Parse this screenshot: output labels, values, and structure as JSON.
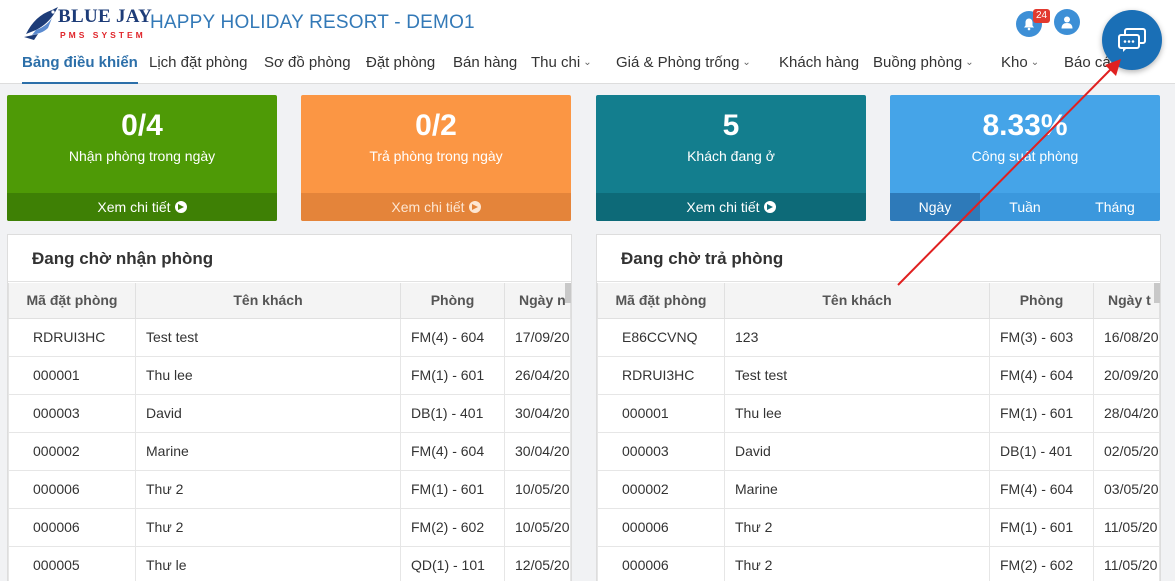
{
  "logo": {
    "name": "BLUE JAY",
    "sub": "PMS SYSTEM"
  },
  "app_title": "HAPPY HOLIDAY RESORT - DEMO1",
  "notifications": {
    "count": "24"
  },
  "nav": [
    "Bảng điều khiển",
    "Lịch đặt phòng",
    "Sơ đồ phòng",
    "Đặt phòng",
    "Bán hàng",
    "Thu chi",
    "Giá & Phòng trống",
    "Khách hàng",
    "Buồng phòng",
    "Kho",
    "Báo cáo"
  ],
  "cards": {
    "checkin": {
      "value": "0/4",
      "label": "Nhận phòng trong ngày",
      "link": "Xem chi tiết"
    },
    "checkout": {
      "value": "0/2",
      "label": "Trả phòng trong ngày",
      "link": "Xem chi tiết"
    },
    "staying": {
      "value": "5",
      "label": "Khách đang ở",
      "link": "Xem chi tiết"
    },
    "occupancy": {
      "value": "8.33%",
      "label": "Công suất phòng",
      "tabs": [
        "Ngày",
        "Tuần",
        "Tháng"
      ]
    }
  },
  "pending_checkin": {
    "title": "Đang chờ nhận phòng",
    "columns": [
      "Mã đặt phòng",
      "Tên khách",
      "Phòng",
      "Ngày n"
    ],
    "rows": [
      [
        "RDRUI3HC",
        "Test test",
        "FM(4) - 604",
        "17/09/20"
      ],
      [
        "000001",
        "Thu lee",
        "FM(1) - 601",
        "26/04/20"
      ],
      [
        "000003",
        "David",
        "DB(1) - 401",
        "30/04/20"
      ],
      [
        "000002",
        "Marine",
        "FM(4) - 604",
        "30/04/20"
      ],
      [
        "000006",
        "Thư 2",
        "FM(1) - 601",
        "10/05/20"
      ],
      [
        "000006",
        "Thư 2",
        "FM(2) - 602",
        "10/05/20"
      ],
      [
        "000005",
        "Thư le",
        "QD(1) - 101",
        "12/05/20"
      ]
    ]
  },
  "pending_checkout": {
    "title": "Đang chờ trả phòng",
    "columns": [
      "Mã đặt phòng",
      "Tên khách",
      "Phòng",
      "Ngày t"
    ],
    "rows": [
      [
        "E86CCVNQ",
        "123",
        "FM(3) - 603",
        "16/08/20"
      ],
      [
        "RDRUI3HC",
        "Test test",
        "FM(4) - 604",
        "20/09/20"
      ],
      [
        "000001",
        "Thu lee",
        "FM(1) - 601",
        "28/04/20"
      ],
      [
        "000003",
        "David",
        "DB(1) - 401",
        "02/05/20"
      ],
      [
        "000002",
        "Marine",
        "FM(4) - 604",
        "03/05/20"
      ],
      [
        "000006",
        "Thư 2",
        "FM(1) - 601",
        "11/05/20"
      ],
      [
        "000006",
        "Thư 2",
        "FM(2) - 602",
        "11/05/20"
      ]
    ]
  },
  "colors": {
    "accent": "#2c6fa9",
    "chat": "#1a6fb6",
    "arrow": "#e02020"
  }
}
